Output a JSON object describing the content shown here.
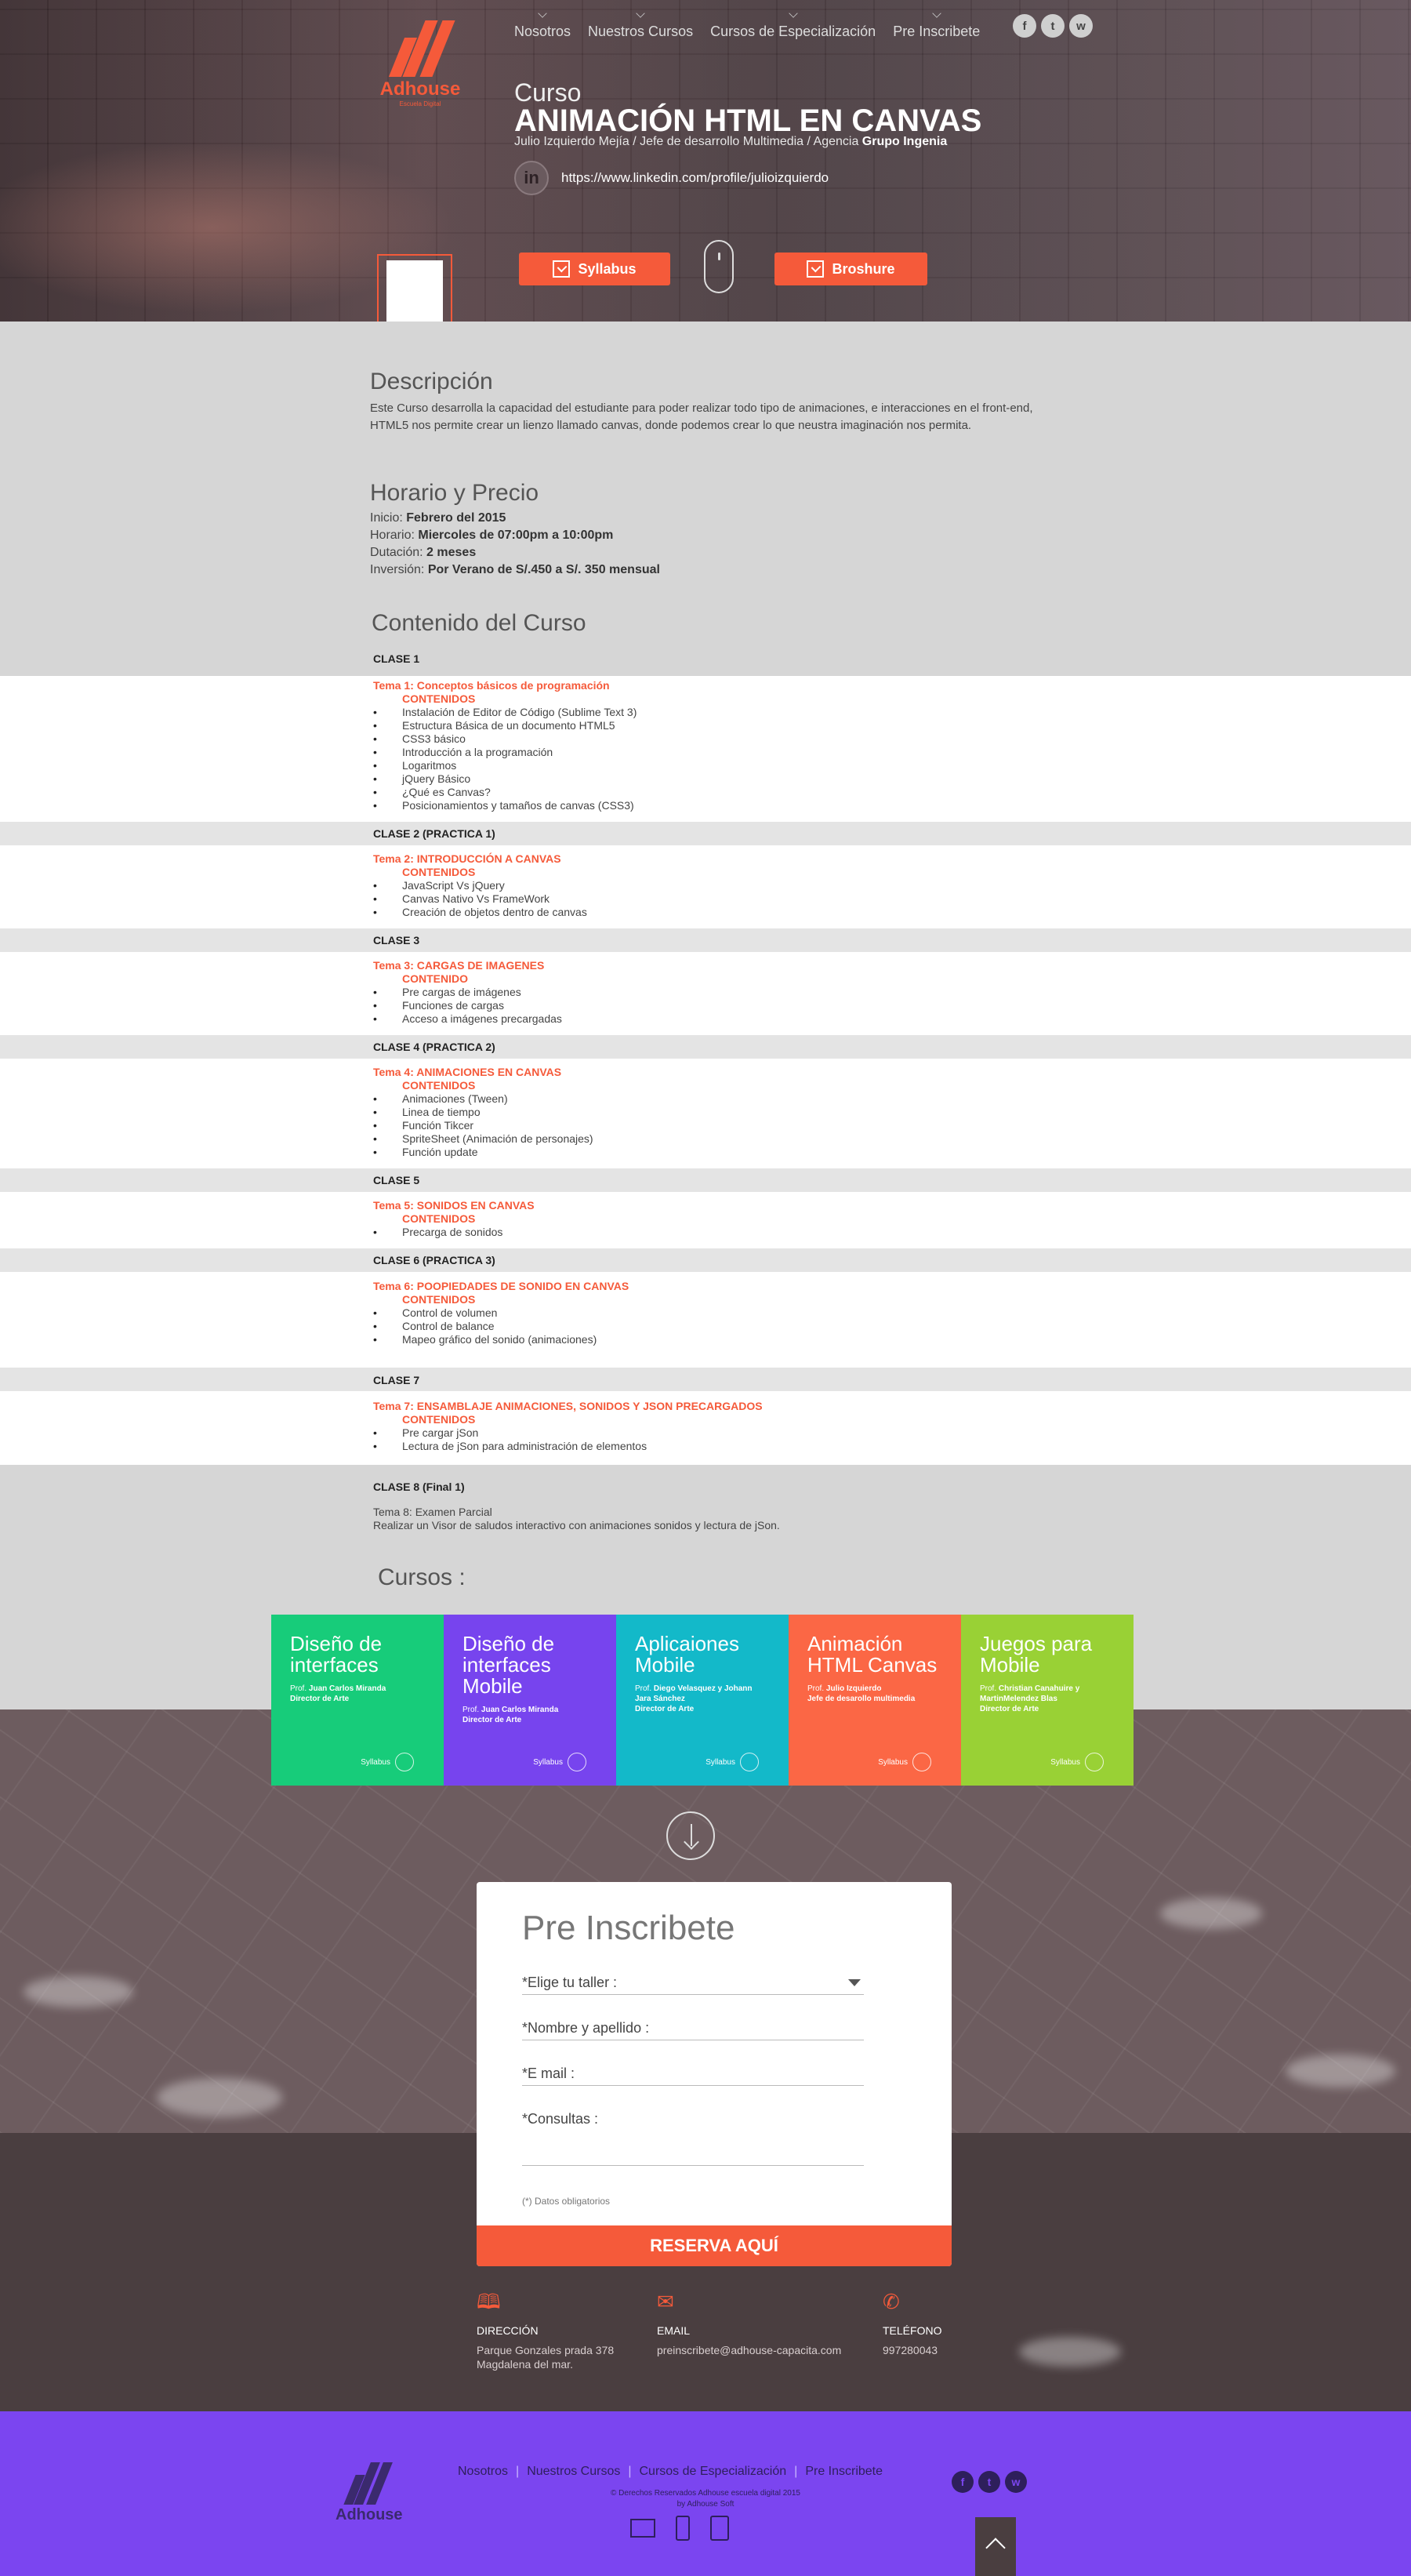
{
  "brand": {
    "name": "Adhouse",
    "tagline": "Escuela Digital",
    "accent": "#f55a3a"
  },
  "nav": [
    "Nosotros",
    "Nuestros Cursos",
    "Cursos de Especialización",
    "Pre Inscribete"
  ],
  "socials": [
    {
      "icon": "facebook-icon",
      "glyph": "f"
    },
    {
      "icon": "twitter-icon",
      "glyph": "t"
    },
    {
      "icon": "whatsapp-icon",
      "glyph": "w"
    }
  ],
  "hero": {
    "kicker": "Curso",
    "title": "ANIMACIÓN HTML EN CANVAS",
    "author": "Julio Izquierdo Mejía / Jefe de desarrollo Multimedia / Agencia ",
    "agency": "Grupo Ingenia",
    "linkedin_glyph": "in",
    "linkedin_url": "https://www.linkedin.com/profile/julioizquierdo",
    "syllabus_label": "Syllabus",
    "brochure_label": "Broshure"
  },
  "descripcion": {
    "heading": "Descripción",
    "text": "Este Curso desarrolla la capacidad del estudiante para poder realizar todo tipo de animaciones, e interacciones en el front-end, HTML5 nos permite crear un lienzo llamado canvas, donde podemos crear lo que neustra imaginación nos permita."
  },
  "horario": {
    "heading": "Horario y Precio",
    "rows": [
      {
        "label": "Inicio: ",
        "value": "Febrero del 2015"
      },
      {
        "label": "Horario: ",
        "value": "Miercoles de 07:00pm a 10:00pm"
      },
      {
        "label": "Dutación: ",
        "value": "2 meses"
      },
      {
        "label": "Inversión: ",
        "value": "Por Verano de S/.450 a S/. 350 mensual"
      }
    ]
  },
  "contenido": {
    "heading": "Contenido del Curso",
    "clases": [
      {
        "label": "CLASE 1",
        "tema": "Tema 1: Conceptos básicos de programación",
        "sub": "CONTENIDOS",
        "items": [
          "Instalación de Editor de Código (Sublime Text 3)",
          "Estructura Básica de un documento HTML5",
          "CSS3 básico",
          "Introducción a la programación",
          "Logaritmos",
          "jQuery Básico",
          "¿Qué es Canvas?",
          "Posicionamientos y tamaños de canvas (CSS3)"
        ]
      },
      {
        "label": "CLASE 2 (PRACTICA 1)",
        "tema": "Tema 2: INTRODUCCIÓN A CANVAS",
        "sub": "CONTENIDOS",
        "items": [
          "JavaScript Vs jQuery",
          "Canvas Nativo Vs FrameWork",
          "Creación de objetos dentro de canvas"
        ]
      },
      {
        "label": "CLASE 3",
        "tema": "Tema 3: CARGAS DE IMAGENES",
        "sub": "CONTENIDO",
        "items": [
          "Pre cargas de imágenes",
          "Funciones de cargas",
          "Acceso a imágenes precargadas"
        ]
      },
      {
        "label": "CLASE 4 (PRACTICA 2)",
        "tema": "Tema 4: ANIMACIONES EN CANVAS",
        "sub": "CONTENIDOS",
        "items": [
          "Animaciones (Tween)",
          "Linea de tiempo",
          "Función Tikcer",
          "SpriteSheet (Animación de personajes)",
          "Función update"
        ]
      },
      {
        "label": "CLASE 5",
        "tema": "Tema 5: SONIDOS EN CANVAS",
        "sub": "CONTENIDOS",
        "items": [
          "Precarga de sonidos"
        ]
      },
      {
        "label": "CLASE 6 (PRACTICA 3)",
        "tema": "Tema 6: POOPIEDADES DE SONIDO EN CANVAS",
        "sub": "CONTENIDOS",
        "items": [
          "Control de volumen",
          "Control de balance",
          "Mapeo gráfico del sonido (animaciones)"
        ]
      },
      {
        "label": "CLASE 7",
        "tema": "Tema 7: ENSAMBLAJE ANIMACIONES, SONIDOS Y JSON PRECARGADOS",
        "sub": "CONTENIDOS",
        "items": [
          "Pre cargar jSon",
          "Lectura de jSon para administración de elementos"
        ]
      }
    ],
    "final": {
      "label": "CLASE 8 (Final 1)",
      "line1": "Tema 8: Examen Parcial",
      "line2": "Realizar un Visor de saludos interactivo con animaciones sonidos y lectura de jSon."
    }
  },
  "cursos": {
    "heading": "Cursos :",
    "cards": [
      {
        "title": "Diseño de interfaces",
        "prof_prefix": "Prof. ",
        "prof": "Juan Carlos Miranda",
        "role": "Director de Arte",
        "color": "#17cc7a",
        "syllabus": "Syllabus"
      },
      {
        "title": "Diseño de interfaces Mobile",
        "prof_prefix": "Prof. ",
        "prof": "Juan Carlos Miranda",
        "role": "Director de Arte",
        "color": "#7744ee",
        "syllabus": "Syllabus"
      },
      {
        "title": "Aplicaiones Mobile",
        "prof_prefix": "Prof. ",
        "prof": "Diego Velasquez y Johann Jara Sánchez",
        "role": "Director de Arte",
        "color": "#13b9c9",
        "syllabus": "Syllabus"
      },
      {
        "title": "Animación HTML Canvas",
        "prof_prefix": "Prof. ",
        "prof": "Julio Izquierdo",
        "role": "Jefe de desarollo multimedia",
        "color": "#fb6745",
        "syllabus": "Syllabus"
      },
      {
        "title": "Juegos para Mobile",
        "prof_prefix": "Prof. ",
        "prof": "Christian Canahuire y MartinMelendez Blas",
        "role": "Director de Arte",
        "color": "#99d135",
        "syllabus": "Syllabus"
      }
    ]
  },
  "form": {
    "title": "Pre Inscribete",
    "taller": "*Elige tu taller :",
    "nombre": "*Nombre y apellido :",
    "email": "*E mail :",
    "consultas": "*Consultas :",
    "note": "(*) Datos obligatorios",
    "submit": "RESERVA AQUÍ"
  },
  "contact": {
    "direccion": {
      "label": "DIRECCIÓN",
      "line1": "Parque Gonzales prada 378",
      "line2": "Magdalena del mar."
    },
    "email": {
      "label": "EMAIL",
      "value": "preinscribete@adhouse-capacita.com"
    },
    "telefono": {
      "label": "TELÉFONO",
      "value": "997280043"
    }
  },
  "footer": {
    "copyright": "© Derechos Reservados Adhouse escuela digital 2015",
    "credit": "by Adhouse Soft"
  },
  "colors": {
    "footer": "#7b45f0",
    "content_bg": "#d6d6d6"
  }
}
